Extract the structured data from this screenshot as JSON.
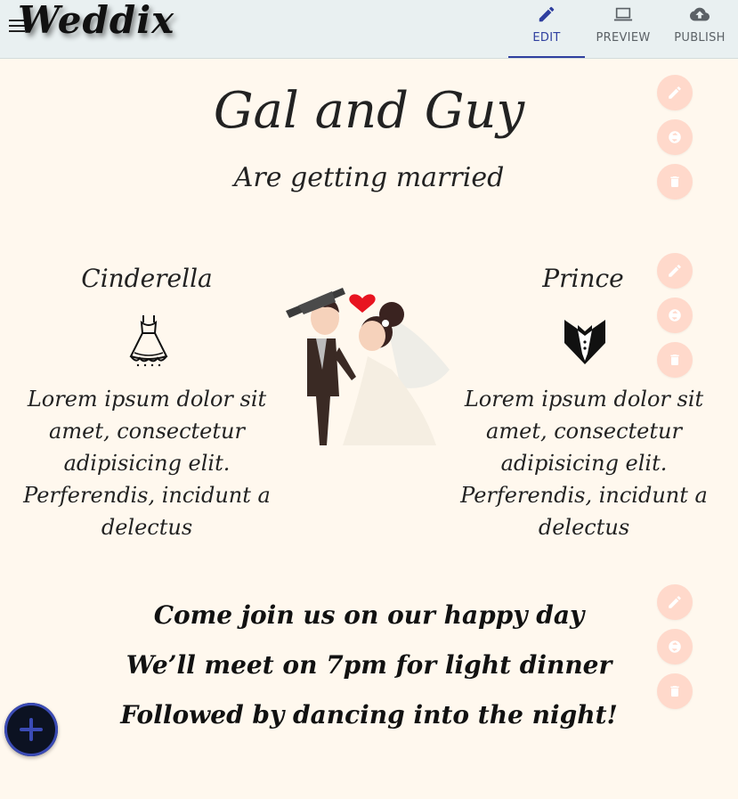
{
  "header": {
    "logo": "Weddix",
    "nav": [
      {
        "label": "EDIT",
        "icon": "pencil-icon",
        "active": true
      },
      {
        "label": "PREVIEW",
        "icon": "laptop-icon",
        "active": false
      },
      {
        "label": "PUBLISH",
        "icon": "cloud-upload-icon",
        "active": false
      }
    ]
  },
  "intro": {
    "title": "Gal and Guy",
    "subtitle": "Are getting married"
  },
  "couple": {
    "bride": {
      "name": "Cinderella",
      "icon": "dress-icon",
      "text_lines": [
        "Lorem ipsum dolor sit",
        "amet, consectetur",
        "adipisicing elit.",
        "Perferendis, incidunt a",
        "delectus"
      ]
    },
    "groom": {
      "name": "Prince",
      "icon": "tuxedo-icon",
      "text_lines": [
        "Lorem ipsum dolor sit",
        "amet, consectetur",
        "adipisicing elit.",
        "Perferendis, incidunt a",
        "delectus"
      ]
    },
    "illustration": "bride-and-groom-illustration"
  },
  "footer": {
    "lines": [
      "Come join us on our happy day",
      "We’ll meet on 7pm for light dinner",
      "Followed by dancing into the night!"
    ]
  },
  "colors": {
    "accent": "#2f3f9f",
    "background": "#fff8ee",
    "header_bg": "#e9f0f1",
    "action_button": "#ffd9cb"
  }
}
